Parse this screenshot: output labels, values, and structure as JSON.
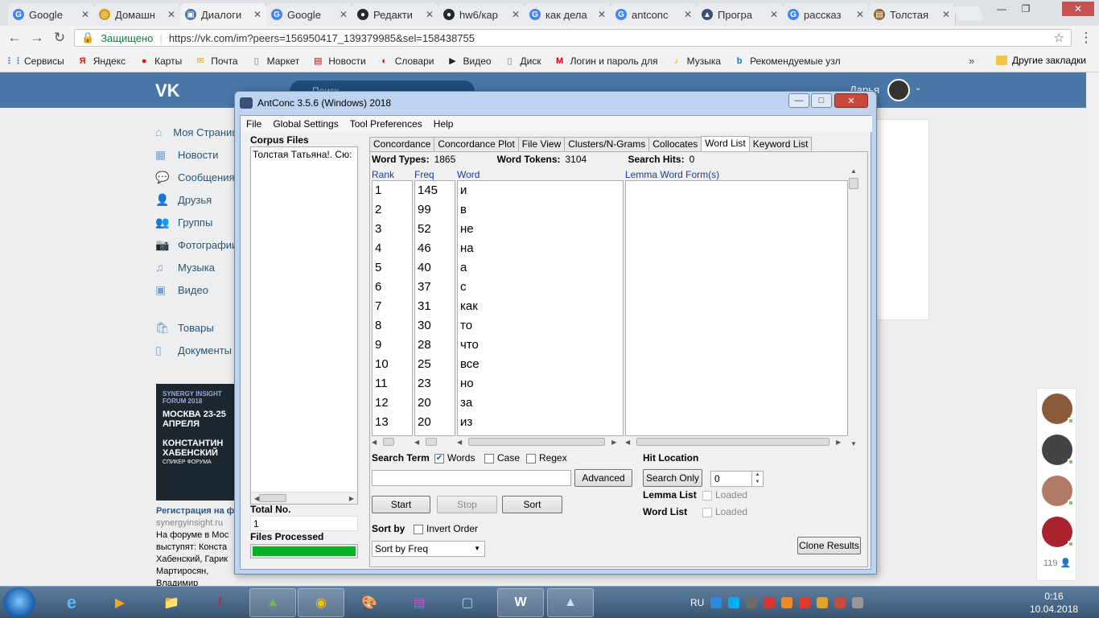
{
  "browser": {
    "tabs": [
      {
        "label": "Google",
        "favicon_color": "#4285f4",
        "glyph": "G"
      },
      {
        "label": "Домашн",
        "favicon_color": "#d4a017",
        "glyph": "◎"
      },
      {
        "label": "Диалоги",
        "favicon_color": "#4a76a8",
        "glyph": "▣",
        "active": true
      },
      {
        "label": "Google",
        "favicon_color": "#4285f4",
        "glyph": "G"
      },
      {
        "label": "Редакти",
        "favicon_color": "#24292e",
        "glyph": "●"
      },
      {
        "label": "hw6/кар",
        "favicon_color": "#24292e",
        "glyph": "●"
      },
      {
        "label": "как дела",
        "favicon_color": "#4285f4",
        "glyph": "G"
      },
      {
        "label": "antconc",
        "favicon_color": "#4285f4",
        "glyph": "G"
      },
      {
        "label": "Програ",
        "favicon_color": "#3b4f77",
        "glyph": "▲"
      },
      {
        "label": "рассказ",
        "favicon_color": "#4285f4",
        "glyph": "G"
      },
      {
        "label": "Толстая",
        "favicon_color": "#8b6a2e",
        "glyph": "▤"
      }
    ],
    "secure_label": "Защищено",
    "url": "https://vk.com/im?peers=156950417_139379985&sel=158438755",
    "bookmarks": [
      {
        "label": "Сервисы",
        "glyph": "⋮⋮",
        "color": "#4285f4"
      },
      {
        "label": "Яндекс",
        "glyph": "Я",
        "color": "#e61400"
      },
      {
        "label": "Карты",
        "glyph": "●",
        "color": "#e61400"
      },
      {
        "label": "Почта",
        "glyph": "✉",
        "color": "#f0a30a"
      },
      {
        "label": "Маркет",
        "glyph": "▯",
        "color": "#777"
      },
      {
        "label": "Новости",
        "glyph": "▤",
        "color": "#c00"
      },
      {
        "label": "Словари",
        "glyph": "◐",
        "color": "#c00"
      },
      {
        "label": "Видео",
        "glyph": "▶",
        "color": "#222"
      },
      {
        "label": "Диск",
        "glyph": "▯",
        "color": "#777"
      },
      {
        "label": "Логин и пароль для",
        "glyph": "M",
        "color": "#d0021b"
      },
      {
        "label": "Музыка",
        "glyph": "♪",
        "color": "#f0a30a"
      },
      {
        "label": "Рекомендуемые узл",
        "glyph": "b",
        "color": "#0078d7"
      }
    ],
    "more_bookmarks": "»",
    "other_bookmarks": "Другие закладки"
  },
  "vk": {
    "logo": "VK",
    "search_placeholder": "Поиск",
    "user_name": "Дарья",
    "menu": [
      {
        "label": "Моя Страница",
        "icon": "home-icon",
        "glyph": "⌂"
      },
      {
        "label": "Новости",
        "icon": "news-icon",
        "glyph": "▦"
      },
      {
        "label": "Сообщения",
        "icon": "messages-icon",
        "glyph": "💬"
      },
      {
        "label": "Друзья",
        "icon": "friends-icon",
        "glyph": "👤"
      },
      {
        "label": "Группы",
        "icon": "groups-icon",
        "glyph": "👥"
      },
      {
        "label": "Фотографии",
        "icon": "camera-icon",
        "glyph": "📷"
      },
      {
        "label": "Музыка",
        "icon": "music-icon",
        "glyph": "♫"
      },
      {
        "label": "Видео",
        "icon": "video-icon",
        "glyph": "▣"
      }
    ],
    "menu2": [
      {
        "label": "Товары",
        "icon": "bag-icon",
        "glyph": "🛍"
      },
      {
        "label": "Документы",
        "icon": "document-icon",
        "glyph": "▯"
      }
    ],
    "ad": {
      "forum": "SYNERGY INSIGHT FORUM 2018",
      "city": "МОСКВА 23-25 АПРЕЛЯ",
      "speaker": "КОНСТАНТИН ХАБЕНСКИЙ",
      "speaker_role": "СПИКЕР ФОРУМА",
      "title": "Регистрация на ф",
      "site": "synergyinsight.ru",
      "text": "На форуме в Мос выступят: Конста Хабенский, Гарик Мартиросян, Владимир"
    },
    "friends_count": "119"
  },
  "antconc": {
    "title": "AntConc 3.5.6 (Windows) 2018",
    "menu": [
      "File",
      "Global Settings",
      "Tool Preferences",
      "Help"
    ],
    "corpus_files_label": "Corpus Files",
    "corpus_files": [
      "Толстая Татьяна!. Сю:"
    ],
    "total_no_label": "Total No.",
    "total_no": "1",
    "files_processed_label": "Files Processed",
    "progress": 1.0,
    "tabs": [
      "Concordance",
      "Concordance Plot",
      "File View",
      "Clusters/N-Grams",
      "Collocates",
      "Word List",
      "Keyword List"
    ],
    "active_tab": "Word List",
    "word_types_label": "Word Types:",
    "word_types": "1865",
    "word_tokens_label": "Word Tokens:",
    "word_tokens": "3104",
    "search_hits_label": "Search Hits:",
    "search_hits": "0",
    "col_rank": "Rank",
    "col_freq": "Freq",
    "col_word": "Word",
    "col_lemma": "Lemma Word Form(s)",
    "rows": [
      {
        "rank": "1",
        "freq": "145",
        "word": "и"
      },
      {
        "rank": "2",
        "freq": "99",
        "word": "в"
      },
      {
        "rank": "3",
        "freq": "52",
        "word": "не"
      },
      {
        "rank": "4",
        "freq": "46",
        "word": "на"
      },
      {
        "rank": "5",
        "freq": "40",
        "word": "а"
      },
      {
        "rank": "6",
        "freq": "37",
        "word": "с"
      },
      {
        "rank": "7",
        "freq": "31",
        "word": "как"
      },
      {
        "rank": "8",
        "freq": "30",
        "word": "то"
      },
      {
        "rank": "9",
        "freq": "28",
        "word": "что"
      },
      {
        "rank": "10",
        "freq": "25",
        "word": "все"
      },
      {
        "rank": "11",
        "freq": "23",
        "word": "но"
      },
      {
        "rank": "12",
        "freq": "20",
        "word": "за"
      },
      {
        "rank": "13",
        "freq": "20",
        "word": "из"
      }
    ],
    "search_term_label": "Search Term",
    "opt_words": "Words",
    "opt_case": "Case",
    "opt_regex": "Regex",
    "advanced_btn": "Advanced",
    "start_btn": "Start",
    "stop_btn": "Stop",
    "sort_btn": "Sort",
    "hit_location_label": "Hit Location",
    "search_only_btn": "Search Only",
    "hit_value": "0",
    "lemma_list_label": "Lemma List",
    "word_list_label": "Word List",
    "loaded_label": "Loaded",
    "sort_by_label": "Sort by",
    "invert_order": "Invert Order",
    "sort_select": "Sort by Freq",
    "clone_btn": "Clone Results"
  },
  "taskbar": {
    "language": "RU",
    "time": "0:16",
    "date": "10.04.2018"
  }
}
